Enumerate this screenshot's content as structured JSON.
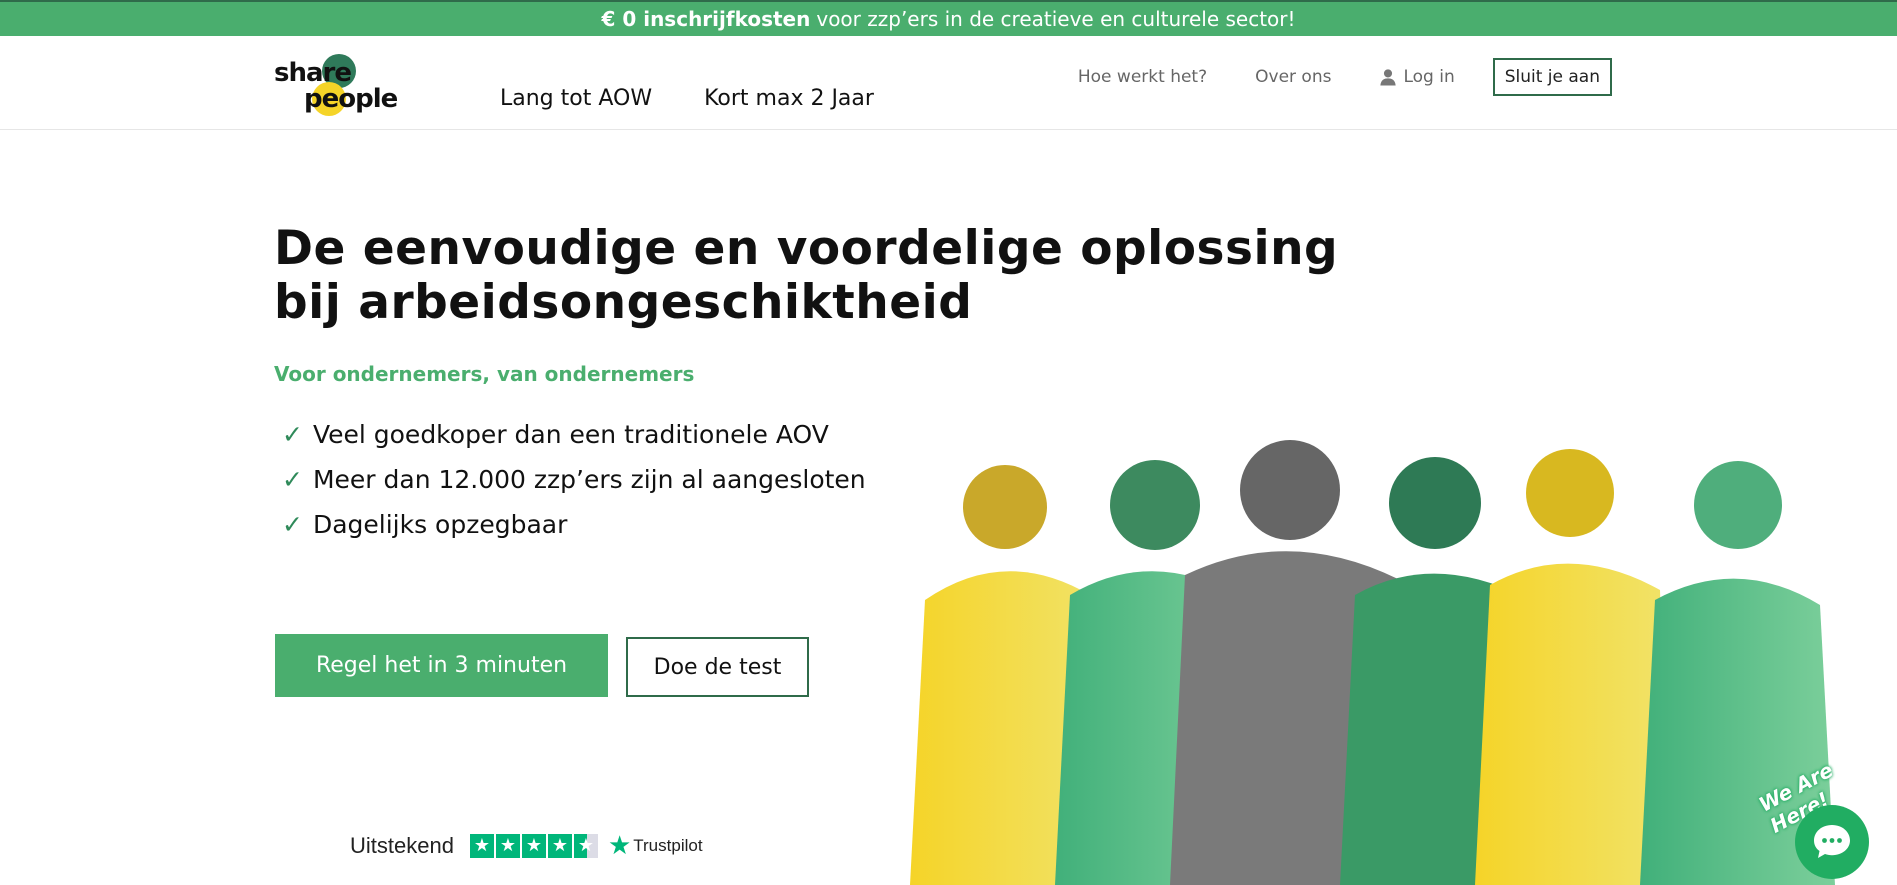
{
  "banner": {
    "bold": "€ 0 inschrijfkosten",
    "rest": "voor zzp’ers in de creatieve en culturele sector!"
  },
  "logo": {
    "word1": "share",
    "word2": "people"
  },
  "main_nav": [
    "Lang tot AOW",
    "Kort max 2 Jaar"
  ],
  "top_nav": {
    "how": "Hoe werkt het?",
    "about": "Over ons",
    "login": "Log in",
    "join": "Sluit je aan"
  },
  "hero": {
    "title_line1": "De eenvoudige en voordelige oplossing",
    "title_line2": "bij arbeidsongeschiktheid",
    "subtitle": "Voor ondernemers, van ondernemers",
    "checks": [
      "Veel goedkoper dan een traditionele AOV",
      "Meer dan 12.000 zzp’ers zijn al aangesloten",
      "Dagelijks opzegbaar"
    ],
    "check_symbol": "✓",
    "primary_cta": "Regel het in 3 minuten",
    "secondary_cta": "Doe de test"
  },
  "trustpilot": {
    "rating_label": "Uitstekend",
    "brand": "Trustpilot",
    "stars": 4.5
  },
  "chat": {
    "badge": "We Are Here!"
  },
  "colors": {
    "brand_green": "#4aae6e",
    "dark_green": "#2f6b4a",
    "brand_yellow": "#f5d428",
    "trustpilot_green": "#00b67a",
    "chat_green": "#21ad62"
  },
  "icons": [
    "user-icon",
    "check-icon",
    "star-icon",
    "chat-icon",
    "trustpilot-star-icon"
  ]
}
